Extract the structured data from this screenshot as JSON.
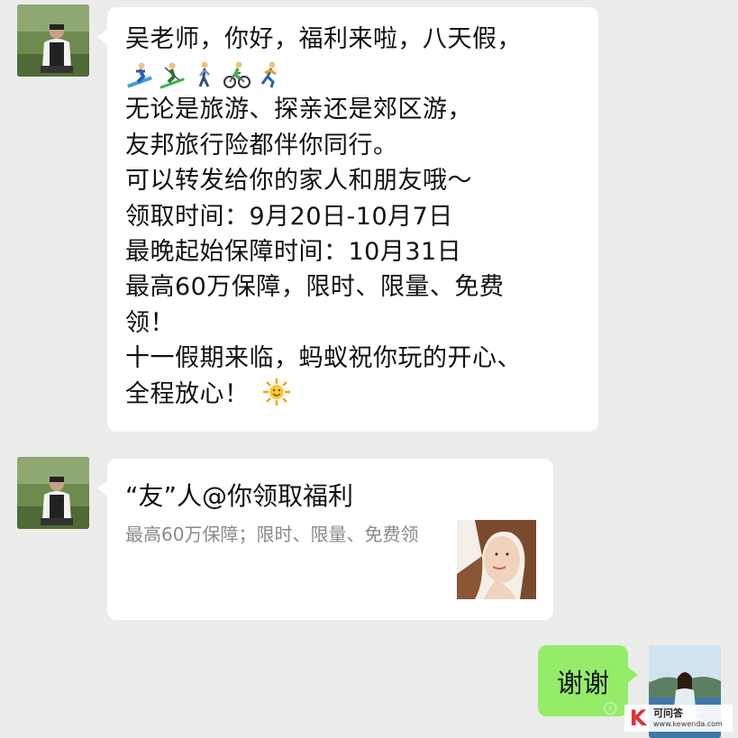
{
  "chat": {
    "message1": {
      "lines": [
        "吴老师，你好，福利来啦，八天假，",
        "无论是旅游、探亲还是郊区游，",
        "友邦旅行险都伴你同行。",
        "可以转发给你的家人和朋友哦～",
        "领取时间：9月20日-10月7日",
        "最晚起始保障时间：10月31日",
        "最高60万保障，限时、限量、免费",
        "领！",
        "十一假期来临，蚂蚁祝你玩的开心、",
        "全程放心！"
      ],
      "emojis": [
        "skier-emoji",
        "skier-emoji",
        "walker-emoji",
        "cyclist-emoji",
        "runner-emoji"
      ],
      "trailing_emoji": "sun-emoji"
    },
    "card": {
      "title": "“友”人@你领取福利",
      "description": "最高60万保障；限时、限量、免费领"
    },
    "reply": {
      "text": "谢谢"
    }
  },
  "watermark": {
    "logo_letter": "K",
    "name": "可问答",
    "url": "www.kewenda.com"
  },
  "colors": {
    "background": "#ececec",
    "incoming_bubble": "#ffffff",
    "outgoing_bubble": "#95ec69",
    "secondary_text": "#8a8a8a"
  }
}
